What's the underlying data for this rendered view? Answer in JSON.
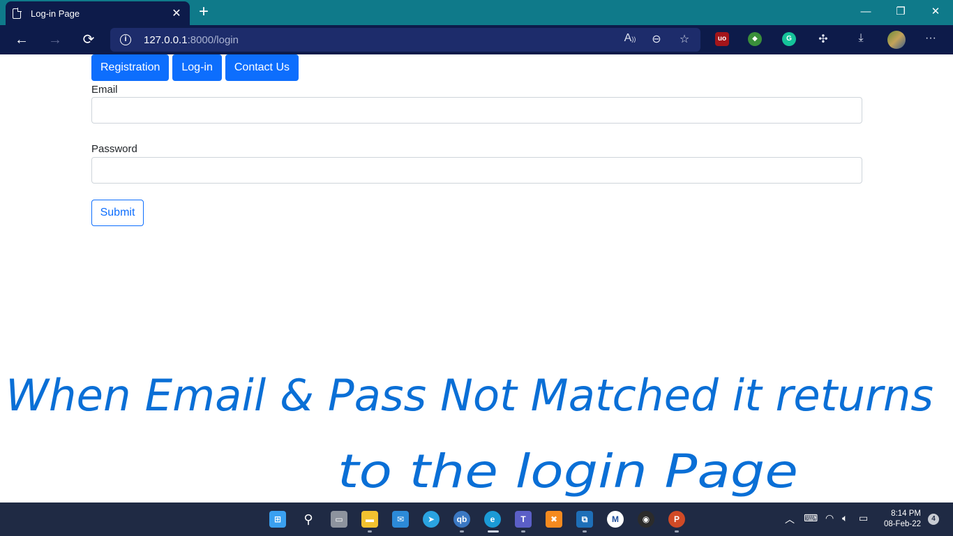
{
  "browser": {
    "tab_title": "Log-in Page",
    "tab_close": "✕",
    "new_tab": "+",
    "url_host": "127.0.0.1",
    "url_path": ":8000/login",
    "window": {
      "minimize": "—",
      "restore": "❐",
      "close": "✕"
    },
    "nav": {
      "back": "←",
      "forward": "→",
      "reload": "⟳"
    },
    "info": "i",
    "menu": "···"
  },
  "page": {
    "nav_links": [
      "Registration",
      "Log-in",
      "Contact Us"
    ],
    "email_label": "Email",
    "password_label": "Password",
    "submit_label": "Submit",
    "accent_color": "#0d6efd"
  },
  "annotation": {
    "line1": "When Email & Pass Not Matched it returns",
    "line2": "to the login Page"
  },
  "taskbar": {
    "time": "8:14 PM",
    "date": "08-Feb-22",
    "notification_count": "4"
  }
}
